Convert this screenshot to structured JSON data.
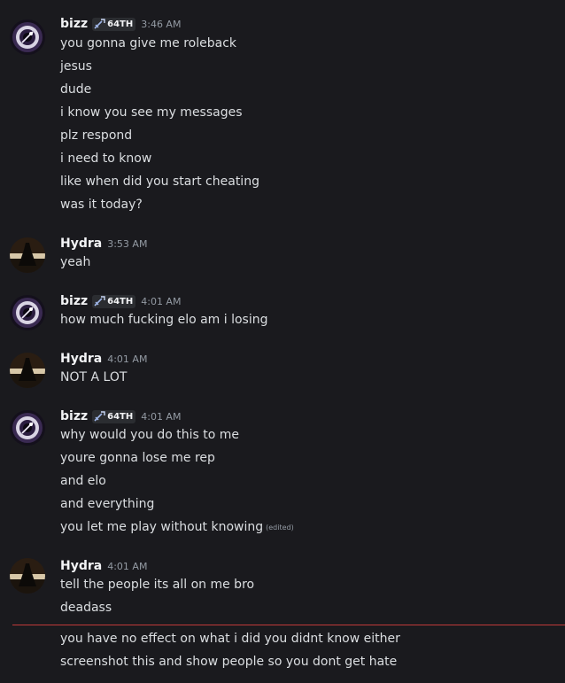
{
  "tag_label": "64TH",
  "edited_label": "(edited)",
  "groups": [
    {
      "username": "bizz",
      "timestamp": "3:46 AM",
      "messages": [
        "you gonna give me roleback",
        "jesus",
        "dude",
        "i know you see my messages",
        "plz respond",
        "i need to know",
        "like when did you start cheating",
        "was it today?"
      ]
    },
    {
      "username": "Hydra",
      "timestamp": "3:53 AM",
      "messages": [
        "yeah"
      ]
    },
    {
      "username": "bizz",
      "timestamp": "4:01 AM",
      "messages": [
        "how much fucking elo am i losing"
      ]
    },
    {
      "username": "Hydra",
      "timestamp": "4:01 AM",
      "messages": [
        "NOT A LOT"
      ]
    },
    {
      "username": "bizz",
      "timestamp": "4:01 AM",
      "messages": [
        "why would you do this to me",
        "youre gonna lose me rep",
        "and elo",
        "and everything",
        "you let me play without knowing"
      ]
    },
    {
      "username": "Hydra",
      "timestamp": "4:01 AM",
      "messages": [
        "tell the people its all on me bro",
        "deadass"
      ]
    }
  ],
  "after_divider": [
    "you have no effect on what i did you didnt know either",
    "screenshot this and show people so you dont get hate"
  ],
  "colors": {
    "background": "#1a1a1e",
    "username": "#f2f3f5",
    "message": "#dbdee1",
    "timestamp": "#949ba4",
    "new_messages_divider": "#c03a3a"
  }
}
